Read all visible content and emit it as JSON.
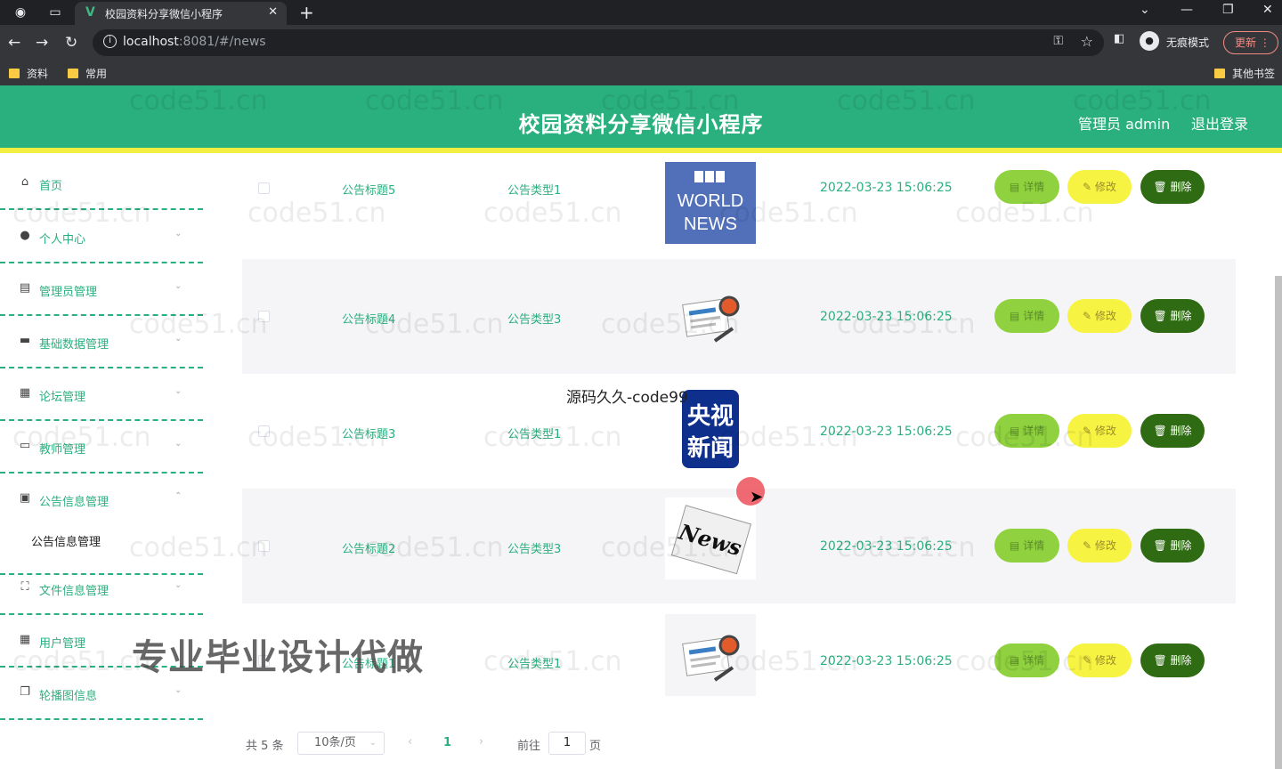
{
  "browser": {
    "tab_title": "校园资料分享微信小程序",
    "url_host": "localhost",
    "url_rest": ":8081/#/news",
    "incognito_label": "无痕模式",
    "update_label": "更新",
    "bookmarks": [
      "资料",
      "常用"
    ],
    "other_bookmarks": "其他书签"
  },
  "app": {
    "title": "校园资料分享微信小程序",
    "admin_label": "管理员 admin",
    "logout_label": "退出登录"
  },
  "sidebar": {
    "items": [
      {
        "label": "首页",
        "icon": "home-icon"
      },
      {
        "label": "个人中心",
        "icon": "user-icon"
      },
      {
        "label": "管理员管理",
        "icon": "doc-icon"
      },
      {
        "label": "基础数据管理",
        "icon": "chat-icon"
      },
      {
        "label": "论坛管理",
        "icon": "forum-icon"
      },
      {
        "label": "教师管理",
        "icon": "card-icon"
      },
      {
        "label": "公告信息管理",
        "icon": "clipboard-icon"
      },
      {
        "label": "文件信息管理",
        "icon": "file-icon"
      },
      {
        "label": "用户管理",
        "icon": "grid-icon"
      },
      {
        "label": "轮播图信息",
        "icon": "copy-icon"
      }
    ],
    "submenu_label": "公告信息管理"
  },
  "table": {
    "rows": [
      {
        "title": "公告标题5",
        "type": "公告类型1",
        "image": "BBC WORLD NEWS",
        "time": "2022-03-23 15:06:25"
      },
      {
        "title": "公告标题4",
        "type": "公告类型3",
        "image": "news-illustration",
        "time": "2022-03-23 15:06:25"
      },
      {
        "title": "公告标题3",
        "type": "公告类型1",
        "image": "央视新闻",
        "time": "2022-03-23 15:06:25"
      },
      {
        "title": "公告标题2",
        "type": "公告类型3",
        "image": "News",
        "time": "2022-03-23 15:06:25"
      },
      {
        "title": "公告标题1",
        "type": "公告类型1",
        "image": "news-illustration",
        "time": "2022-03-23 15:06:25"
      }
    ],
    "btn_detail": "详情",
    "btn_edit": "修改",
    "btn_delete": "删除"
  },
  "pagination": {
    "total": "共 5 条",
    "page_size": "10条/页",
    "current": "1",
    "goto_label": "前往",
    "goto_value": "1",
    "page_suffix": "页"
  },
  "overlays": {
    "caption_top": "源码久久-code99",
    "caption_big": "专业毕业设计代做",
    "watermark": "code51.cn"
  },
  "colors": {
    "primary": "#2ab07f",
    "header_stripe": "#f2ef42",
    "detail_btn": "#8fd13f",
    "edit_btn": "#f7f343",
    "delete_btn": "#2e6b12"
  }
}
